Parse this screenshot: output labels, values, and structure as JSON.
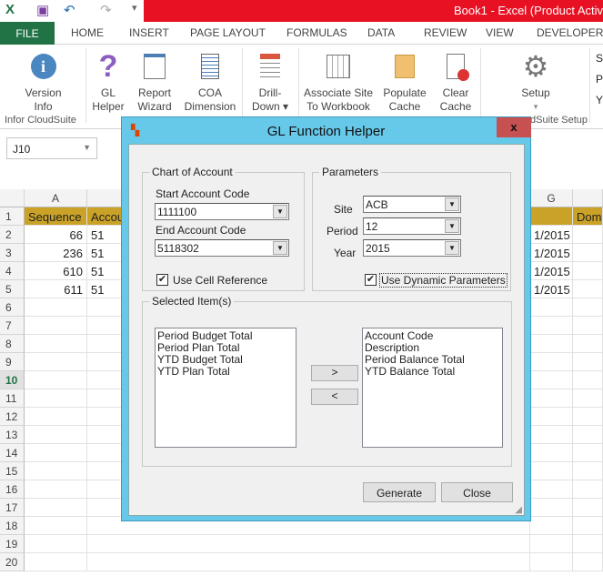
{
  "window": {
    "title": "Book1 -  Excel (Product Activ"
  },
  "tabs": [
    "FILE",
    "HOME",
    "INSERT",
    "PAGE LAYOUT",
    "FORMULAS",
    "DATA",
    "REVIEW",
    "VIEW",
    "DEVELOPER"
  ],
  "ribbon": {
    "buttons": [
      {
        "line1": "Version",
        "line2": "Info",
        "icon": "info-icon"
      },
      {
        "line1": "GL",
        "line2": "Helper",
        "icon": "question-icon"
      },
      {
        "line1": "Report",
        "line2": "Wizard",
        "icon": "report-wizard-icon"
      },
      {
        "line1": "COA",
        "line2": "Dimension",
        "icon": "coa-icon"
      },
      {
        "line1": "Drill-",
        "line2": "Down ▾",
        "icon": "drill-down-icon"
      },
      {
        "line1": "Associate Site",
        "line2": "To Workbook",
        "icon": "associate-site-icon"
      },
      {
        "line1": "Populate",
        "line2": "Cache",
        "icon": "populate-cache-icon"
      },
      {
        "line1": "Clear",
        "line2": "Cache",
        "icon": "clear-cache-icon"
      },
      {
        "line1": "Setup",
        "line2": "▾",
        "icon": "gear-icon"
      }
    ],
    "group_labels": [
      "Infor CloudSuite",
      "dSuite Setup"
    ],
    "right_letters": [
      "S",
      "P",
      "Y"
    ]
  },
  "name_box": "J10",
  "sheet": {
    "columns": [
      "A",
      "B",
      "G"
    ],
    "rows": [
      "1",
      "2",
      "3",
      "4",
      "5",
      "6",
      "7",
      "8",
      "9",
      "10",
      "11",
      "12",
      "13",
      "14",
      "15",
      "16",
      "17",
      "18",
      "19",
      "20"
    ],
    "header": [
      "Sequence",
      "Accou",
      "",
      "Dome"
    ],
    "data": [
      [
        "66",
        "51",
        "1/2015"
      ],
      [
        "236",
        "51",
        "1/2015"
      ],
      [
        "610",
        "51",
        "1/2015"
      ],
      [
        "611",
        "51",
        "1/2015"
      ]
    ],
    "header_color": "#c9a227"
  },
  "dialog": {
    "title": "GL Function Helper",
    "close": "x",
    "coa": {
      "group": "Chart of Account",
      "start_label": "Start Account Code",
      "start_value": "1111100",
      "end_label": "End Account Code",
      "end_value": "5118302",
      "use_cell_ref": "Use Cell Reference",
      "use_cell_ref_checked": true
    },
    "params": {
      "group": "Parameters",
      "site_label": "Site",
      "site": "ACB",
      "period_label": "Period",
      "period": "12",
      "year_label": "Year",
      "year": "2015",
      "dynamic": "Use Dynamic Parameters",
      "dynamic_checked": true
    },
    "selected": {
      "group": "Selected Item(s)",
      "left": [
        "Period Budget Total",
        "Period Plan Total",
        "YTD Budget Total",
        "YTD Plan Total"
      ],
      "right": [
        "Account Code",
        "Description",
        "Period Balance Total",
        "YTD Balance Total"
      ],
      "add": ">",
      "remove": "<"
    },
    "generate": "Generate",
    "close_button": "Close"
  }
}
